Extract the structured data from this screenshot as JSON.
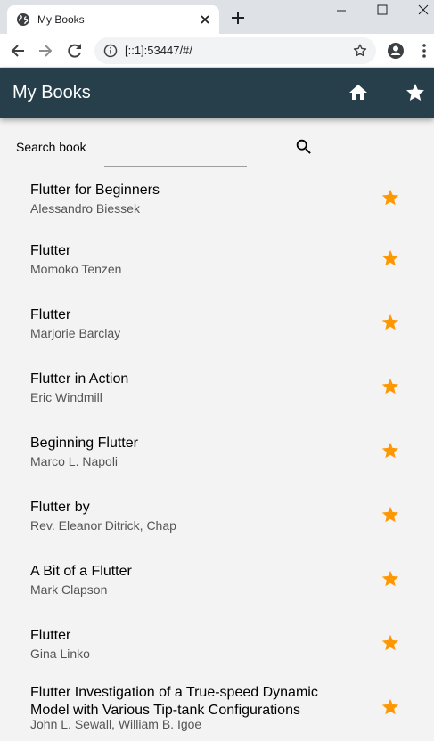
{
  "browser": {
    "tab_title": "My Books",
    "url": "[::1]:53447/#/"
  },
  "app": {
    "title": "My Books"
  },
  "search": {
    "label": "Search book",
    "value": ""
  },
  "colors": {
    "appbar": "#263f4b",
    "star": "#ff9800"
  },
  "books": [
    {
      "title": "Flutter for Beginners",
      "author": "Alessandro Biessek"
    },
    {
      "title": "Flutter",
      "author": "Momoko Tenzen"
    },
    {
      "title": "Flutter",
      "author": "Marjorie Barclay"
    },
    {
      "title": "Flutter in Action",
      "author": "Eric Windmill"
    },
    {
      "title": "Beginning Flutter",
      "author": "Marco L. Napoli"
    },
    {
      "title": "Flutter by",
      "author": "Rev. Eleanor Ditrick, Chap"
    },
    {
      "title": "A Bit of a Flutter",
      "author": "Mark Clapson"
    },
    {
      "title": "Flutter",
      "author": "Gina Linko"
    },
    {
      "title": "Flutter Investigation of a True-speed Dynamic Model with Various Tip-tank Configurations",
      "author": "John L. Sewall, William B. Igoe"
    }
  ]
}
